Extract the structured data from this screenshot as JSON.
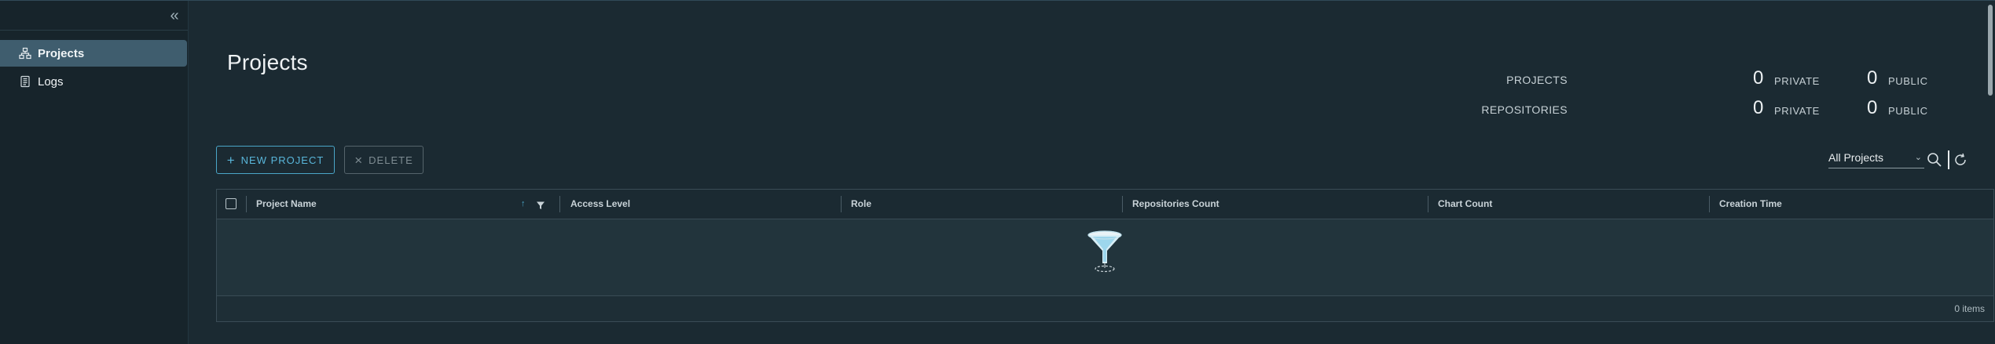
{
  "sidebar": {
    "collapse_glyph": "«",
    "items": [
      {
        "label": "Projects",
        "icon": "projects-icon",
        "active": true
      },
      {
        "label": "Logs",
        "icon": "logs-icon",
        "active": false
      }
    ]
  },
  "main": {
    "title": "Projects",
    "stats": {
      "projects_label": "PROJECTS",
      "projects_private": "0",
      "projects_public": "0",
      "repositories_label": "REPOSITORIES",
      "repositories_private": "0",
      "repositories_public": "0",
      "private_label": "PRIVATE",
      "public_label": "PUBLIC"
    },
    "toolbar": {
      "new_project_label": "NEW PROJECT",
      "delete_label": "DELETE",
      "filter_value": "All Projects"
    },
    "table": {
      "columns": [
        "Project Name",
        "Access Level",
        "Role",
        "Repositories Count",
        "Chart Count",
        "Creation Time"
      ],
      "rows": [],
      "footer": "0 items"
    }
  },
  "colors": {
    "background": "#1b2a32",
    "sidebar": "#17242b",
    "active_nav": "#3f5d6e",
    "accent": "#4aa6c8"
  }
}
